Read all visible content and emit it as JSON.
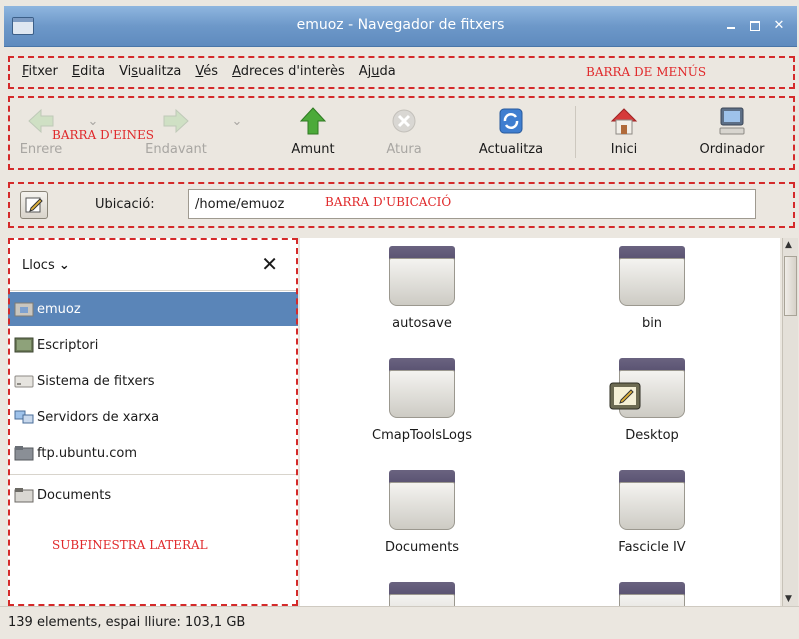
{
  "window": {
    "title": "emuoz - Navegador de fitxers"
  },
  "menubar": {
    "items": [
      {
        "pre": "",
        "u": "F",
        "post": "itxer"
      },
      {
        "pre": "",
        "u": "E",
        "post": "dita"
      },
      {
        "pre": "Vi",
        "u": "s",
        "post": "ualitza"
      },
      {
        "pre": "",
        "u": "V",
        "post": "és"
      },
      {
        "pre": "",
        "u": "A",
        "post": "dreces d'interès"
      },
      {
        "pre": "Aj",
        "u": "u",
        "post": "da"
      }
    ],
    "annotation": "BARRA DE MENÚS"
  },
  "toolbar": {
    "back": "Enrere",
    "forward": "Endavant",
    "up": "Amunt",
    "stop": "Atura",
    "reload": "Actualitza",
    "home": "Inici",
    "computer": "Ordinador",
    "annotation": "BARRA D'EINES"
  },
  "location": {
    "label": "Ubicació:",
    "value": "/home/emuoz",
    "annotation": "BARRA D'UBICACIÓ"
  },
  "sidebar": {
    "title": "Llocs",
    "items": [
      {
        "label": "emuoz",
        "icon": "home-folder-icon"
      },
      {
        "label": "Escriptori",
        "icon": "desktop-icon"
      },
      {
        "label": "Sistema de fitxers",
        "icon": "drive-icon"
      },
      {
        "label": "Servidors de xarxa",
        "icon": "network-icon"
      },
      {
        "label": "ftp.ubuntu.com",
        "icon": "remote-folder-icon"
      },
      {
        "label": "Documents",
        "icon": "folder-icon"
      }
    ],
    "annotation": "SUBFINESTRA LATERAL"
  },
  "files": [
    {
      "name": "autosave"
    },
    {
      "name": "bin"
    },
    {
      "name": "CmapToolsLogs"
    },
    {
      "name": "Desktop"
    },
    {
      "name": "Documents"
    },
    {
      "name": "Fascicle IV"
    },
    {
      "name": ""
    },
    {
      "name": ""
    }
  ],
  "status": {
    "text": "139 elements, espai lliure: 103,1 GB"
  }
}
